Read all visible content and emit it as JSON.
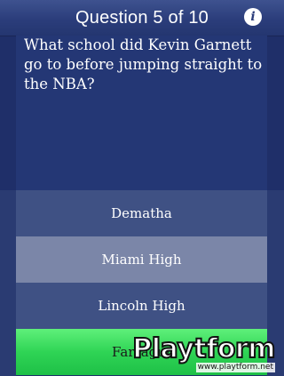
{
  "header": {
    "title": "Question 5 of 10",
    "info_glyph": "i",
    "info_icon": "info-icon"
  },
  "question": {
    "text": "What school did Kevin Garnett go to before jumping straight to the NBA?"
  },
  "answers": [
    {
      "label": "Dematha",
      "state": "default"
    },
    {
      "label": "Miami High",
      "state": "highlighted"
    },
    {
      "label": "Lincoln High",
      "state": "default"
    },
    {
      "label": "Farragut",
      "state": "correct"
    }
  ],
  "watermark": {
    "logo": "Playtform",
    "url": "www.playtform.net"
  },
  "colors": {
    "background": "#1f2f69",
    "header": "#2b3d7b",
    "answer_default": "#3f5184",
    "answer_highlighted": "#7b86a8",
    "answer_correct": "#2fd455"
  }
}
